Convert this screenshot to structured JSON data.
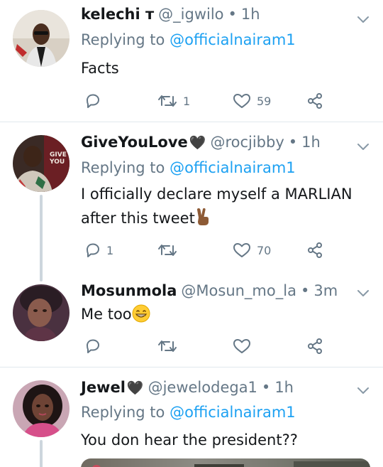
{
  "replying_label": "Replying to",
  "tweets": [
    {
      "name": "kelechi ᴛ",
      "handle": "@_igwilo",
      "dot": "•",
      "time": "1h",
      "replying_to": "@officialnairam1",
      "text": "Facts",
      "replies": "",
      "retweets": "1",
      "likes": "59"
    },
    {
      "name": "GiveYouLove",
      "name_emoji": "🖤",
      "handle": "@rocjibby",
      "dot": "•",
      "time": "1h",
      "replying_to": "@officialnairam1",
      "text_line1": "I officially declare myself a MARLIAN",
      "text_line2": "after this tweet",
      "text_emoji": "✌🏾",
      "replies": "1",
      "retweets": "",
      "likes": "70"
    },
    {
      "name": "Mosunmola",
      "handle": "@Mosun_mo_la",
      "dot": "•",
      "time": "3m",
      "text": "Me too",
      "text_emoji": "😁",
      "replies": "",
      "retweets": "",
      "likes": ""
    },
    {
      "name": "Jewel",
      "name_emoji": "🖤",
      "handle": "@jewelodega1",
      "dot": "•",
      "time": "1h",
      "replying_to": "@officialnairam1",
      "text": "You don hear the president??"
    }
  ],
  "colors": {
    "accent": "#1da1f2",
    "muted": "#657786",
    "divider": "#e1e8ed",
    "thread_line": "#cdd6dd"
  },
  "icons": [
    "chevron-down-icon",
    "reply-icon",
    "retweet-icon",
    "like-icon",
    "share-icon"
  ]
}
